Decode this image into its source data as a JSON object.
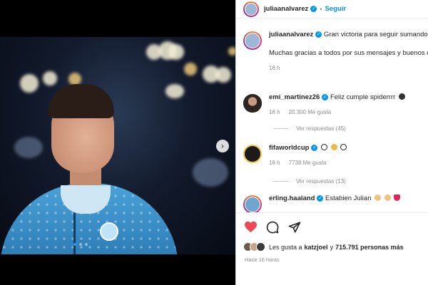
{
  "header": {
    "username": "juliaanalvarez",
    "separator": "•",
    "follow_label": "Seguir"
  },
  "media": {
    "next_icon": "chevron-right-icon",
    "pager": {
      "count": 3,
      "active_index": 0
    }
  },
  "caption": {
    "username": "juliaanalvarez",
    "text": "Gran victoria para seguir sumando en un día muy especial",
    "text2": "Muchas gracias a todos por sus mensajes y buenos deseos",
    "time": "16 h"
  },
  "comments": [
    {
      "username": "emi_martinez26",
      "text": "Feliz cumple spiderrrr",
      "time": "16 h",
      "likes": "20.300 Me gusta",
      "replies": "Ver respuestas (45)"
    },
    {
      "username": "fifaworldcup",
      "text": "",
      "time": "16 h",
      "likes": "7738 Me gusta",
      "replies": "Ver respuestas (13)"
    },
    {
      "username": "erling.haaland",
      "text": "Estabien Julian"
    }
  ],
  "actions": {
    "like_icon": "heart-icon",
    "comment_icon": "comment-icon",
    "share_icon": "share-icon",
    "like_color": "#ed4956"
  },
  "likes": {
    "prefix": "Les gusta a",
    "user": "katzjoel",
    "middle": "y",
    "count": "715.791 personas más"
  },
  "posted": "Hace 16 horas",
  "colors": {
    "accent": "#0095f6",
    "text": "#262626",
    "muted": "#8e8e8e"
  }
}
